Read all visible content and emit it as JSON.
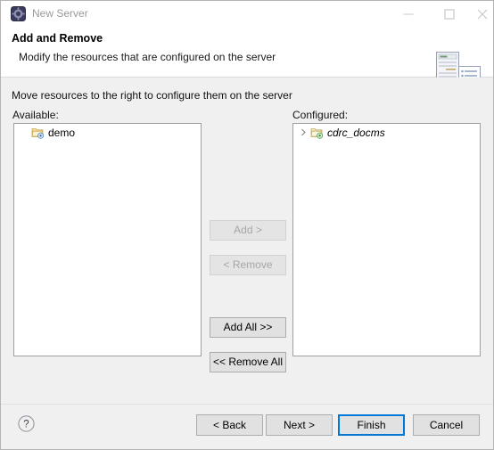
{
  "window": {
    "title": "New Server",
    "app_icon": "server-gear-icon",
    "controls": {
      "minimize": "minimize-icon",
      "maximize": "maximize-icon",
      "close": "close-icon"
    }
  },
  "header": {
    "title": "Add and Remove",
    "description": "Modify the resources that are configured on the server",
    "art_icon": "server-tower-and-document-icon"
  },
  "body": {
    "intro": "Move resources to the right to configure them on the server",
    "available": {
      "label": "Available:",
      "items": [
        {
          "name": "demo",
          "icon": "project-folder-icon",
          "italic": false,
          "expandable": false
        }
      ]
    },
    "configured": {
      "label": "Configured:",
      "items": [
        {
          "name": "cdrc_docms",
          "icon": "project-folder-deployed-icon",
          "italic": true,
          "expandable": true,
          "twisty": "›"
        }
      ]
    },
    "transfer_buttons": [
      {
        "label": "Add >",
        "enabled": false
      },
      {
        "label": "< Remove",
        "enabled": false
      },
      {
        "label": "Add All >>",
        "enabled": true
      },
      {
        "label": "<< Remove All",
        "enabled": true
      }
    ]
  },
  "footer": {
    "help_icon": "help-question-icon",
    "buttons": {
      "back": "< Back",
      "next": "Next >",
      "finish": "Finish",
      "cancel": "Cancel"
    },
    "default_button": "Finish"
  },
  "colors": {
    "dialog_background": "#f0f0f0",
    "header_background": "#ffffff",
    "focus_blue": "#0078d7",
    "list_background": "#ffffff",
    "disabled_text": "#a6a6a6"
  }
}
